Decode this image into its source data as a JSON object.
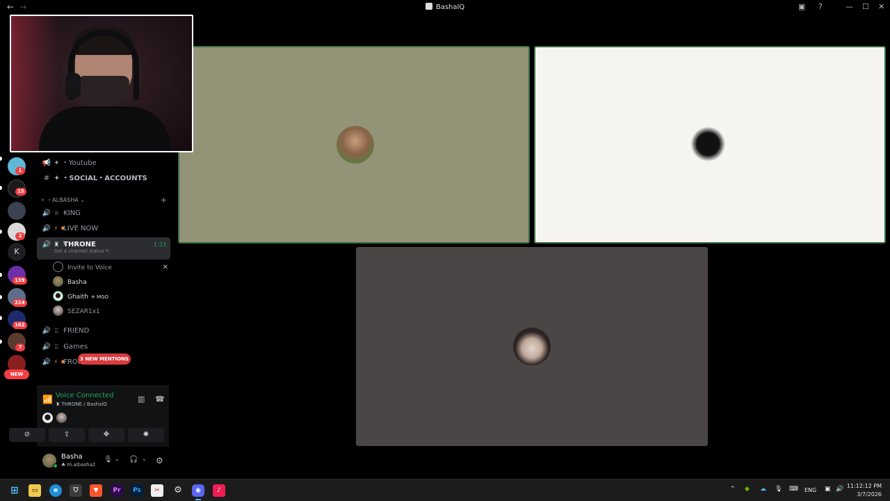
{
  "window": {
    "title": "BashalQ"
  },
  "channels": [
    {
      "label": "Youtube",
      "prefix": "✦ ・",
      "type": "announce"
    },
    {
      "label": "SOCIAL・ACCOUNTS",
      "prefix": "✦ ・",
      "type": "text"
    }
  ],
  "category": {
    "label": "ALBASHA",
    "prefix": "✧ ・"
  },
  "voice_channels": [
    {
      "label": "KING",
      "prefix": "♕ ・"
    },
    {
      "label": "LIVE NOW",
      "prefix": "⚡ ♦"
    },
    {
      "label": "THRONE",
      "prefix": "♜ ・",
      "time": "1:23",
      "status": "Set a channel status ✎"
    },
    {
      "label": "FRIEND",
      "prefix": "♖ ・"
    },
    {
      "label": "Games",
      "prefix": "♖ ・"
    },
    {
      "label": "FROM THE LIVE",
      "prefix": "⚡ ♦"
    }
  ],
  "voice_users": [
    {
      "label": "Invite to Voice",
      "close": "✕"
    },
    {
      "label": "Basha"
    },
    {
      "label": "Ghaith",
      "tag": "✈ MGO"
    },
    {
      "label": "SEZAR1x1"
    }
  ],
  "rail": {
    "badges": [
      "1",
      "15",
      "2",
      "139",
      "224",
      "162",
      "7"
    ],
    "letter": "K",
    "new_label": "NEW"
  },
  "mentions_label": "3 NEW MENTIONS",
  "voice_panel": {
    "title": "Voice Connected",
    "subtitle": "♜ THRONE / BashalQ"
  },
  "user": {
    "name": "Basha",
    "handle": "♣ m.albasha2"
  },
  "taskbar": {
    "lang": "ENG",
    "time": "11:12:12 PM",
    "date": "3/7/2026"
  },
  "colors": {
    "speaking": "#3a6e45",
    "online": "#23a55a",
    "badge": "#f23f43",
    "tile1": "#939377",
    "tile2": "#f5f4f0",
    "tile3": "#4a4646"
  }
}
